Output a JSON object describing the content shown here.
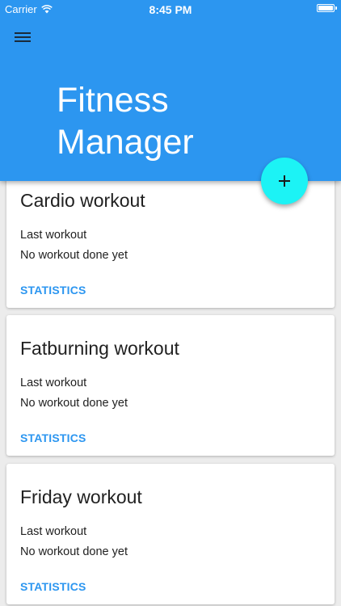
{
  "status_bar": {
    "carrier": "Carrier",
    "time": "8:45 PM"
  },
  "header": {
    "title_line1": "Fitness",
    "title_line2": "Manager",
    "color": "#2c96f0"
  },
  "fab": {
    "label": "+",
    "color": "#1cf3f5"
  },
  "cards": [
    {
      "title": "Cardio workout",
      "label": "Last workout",
      "value": "No workout done yet",
      "action": "STATISTICS"
    },
    {
      "title": "Fatburning workout",
      "label": "Last workout",
      "value": "No workout done yet",
      "action": "STATISTICS"
    },
    {
      "title": "Friday workout",
      "label": "Last workout",
      "value": "No workout done yet",
      "action": "STATISTICS"
    }
  ]
}
